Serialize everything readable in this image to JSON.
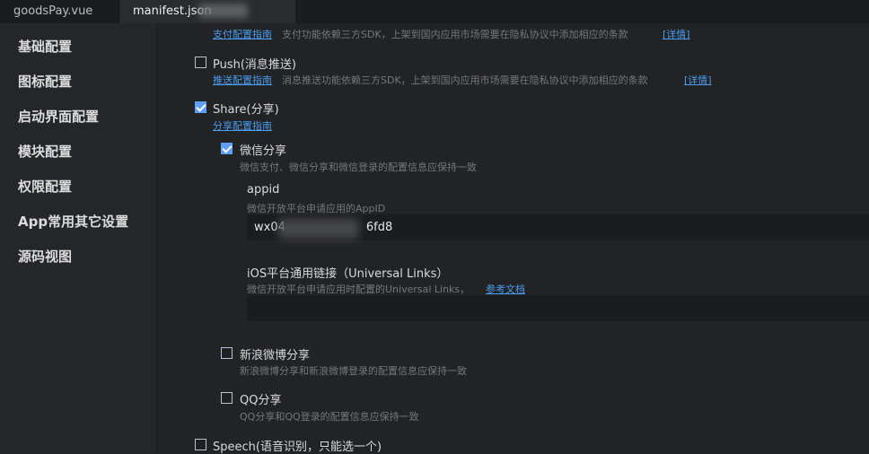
{
  "tabs": [
    {
      "label": "goodsPay.vue"
    },
    {
      "label": "manifest.json"
    }
  ],
  "sidebar": {
    "items": [
      {
        "label": "基础配置"
      },
      {
        "label": "图标配置"
      },
      {
        "label": "启动界面配置"
      },
      {
        "label": "模块配置"
      },
      {
        "label": "权限配置"
      },
      {
        "label": "App常用其它设置"
      },
      {
        "label": "源码视图"
      }
    ]
  },
  "main": {
    "pay": {
      "link": "支付配置指南",
      "desc": "支付功能依赖三方SDK，上架到国内应用市场需要在隐私协议中添加相应的条款",
      "detail": "[详情]"
    },
    "push": {
      "label": "Push(消息推送)",
      "link": "推送配置指南",
      "desc": "消息推送功能依赖三方SDK，上架到国内应用市场需要在隐私协议中添加相应的条款",
      "detail": "[详情]",
      "checked": false
    },
    "share": {
      "label": "Share(分享)",
      "link": "分享配置指南",
      "checked": true,
      "weixin": {
        "label": "微信分享",
        "desc": "微信支付、微信分享和微信登录的配置信息应保持一致",
        "checked": true,
        "appid_label": "appid",
        "appid_desc": "微信开放平台申请应用的AppID",
        "appid_value": "wx04",
        "appid_value_tail": "6fd8",
        "ul_label": "iOS平台通用链接（Universal Links）",
        "ul_desc": "微信开放平台申请应用时配置的Universal Links，",
        "ul_link": "参考文档",
        "ul_value": ""
      },
      "weibo": {
        "label": "新浪微博分享",
        "desc": "新浪微博分享和新浪微博登录的配置信息应保持一致",
        "checked": false
      },
      "qq": {
        "label": "QQ分享",
        "desc": "QQ分享和QQ登录的配置信息应保持一致",
        "checked": false
      }
    },
    "speech": {
      "label": "Speech(语音识别，只能选一个)",
      "checked": false
    }
  }
}
